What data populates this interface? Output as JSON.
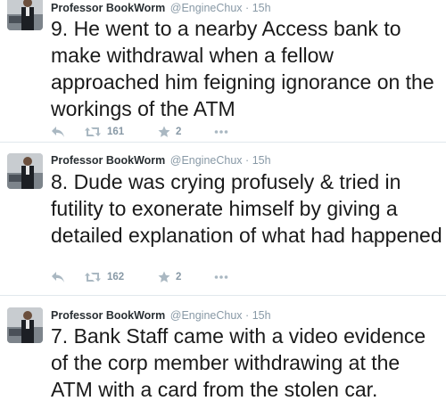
{
  "colors": {
    "name": "#292f33",
    "meta": "#8899a6",
    "icon": "#aab8c2",
    "divider": "#e1e8ed"
  },
  "tweets": [
    {
      "fullname": "Professor BookWorm",
      "username": "@EngineChux",
      "separator": "·",
      "time": "15h",
      "text": "9. He went to a nearby Access bank to make withdrawal when a fellow approached him feigning ignorance on the workings of the ATM",
      "retweets": "161",
      "favorites": "2",
      "icons": [
        "reply-icon",
        "retweet-icon",
        "star-icon",
        "more-icon"
      ]
    },
    {
      "fullname": "Professor BookWorm",
      "username": "@EngineChux",
      "separator": "·",
      "time": "15h",
      "text": "8. Dude was crying profusely & tried in futility to exonerate himself by giving a detailed explanation of what had happened",
      "retweets": "162",
      "favorites": "2",
      "icons": [
        "reply-icon",
        "retweet-icon",
        "star-icon",
        "more-icon"
      ]
    },
    {
      "fullname": "Professor BookWorm",
      "username": "@EngineChux",
      "separator": "·",
      "time": "15h",
      "text": "7. Bank Staff came with a video evidence of the corp member withdrawing at the ATM with a card from the stolen car."
    }
  ]
}
